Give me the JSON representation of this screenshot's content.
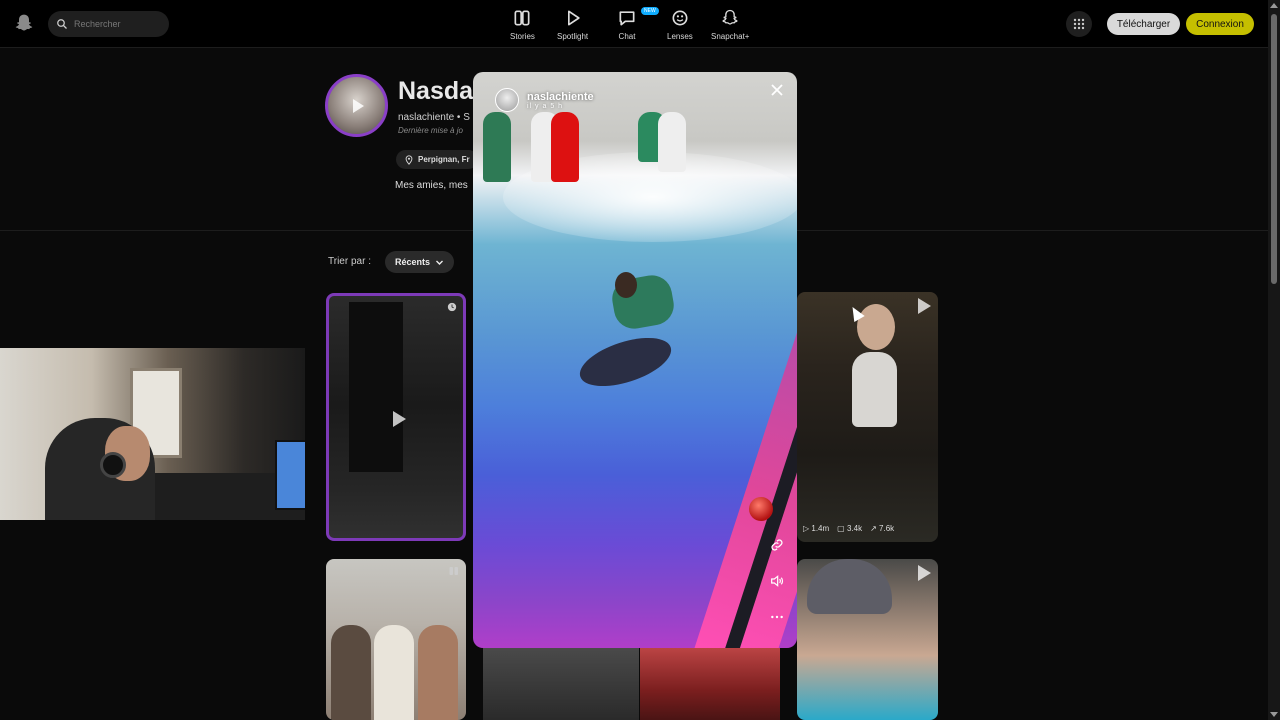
{
  "header": {
    "search_placeholder": "Rechercher",
    "nav": [
      {
        "label": "Stories",
        "icon": "stories-icon"
      },
      {
        "label": "Spotlight",
        "icon": "spotlight-play-icon"
      },
      {
        "label": "Chat",
        "icon": "chat-icon",
        "badge": "NEW"
      },
      {
        "label": "Lenses",
        "icon": "lenses-icon"
      },
      {
        "label": "Snapchat+",
        "icon": "snapchat-plus-icon"
      }
    ],
    "download_label": "Télécharger",
    "login_label": "Connexion",
    "accent": "#c5bf00"
  },
  "profile": {
    "display_name": "Nasdas",
    "username": "naslachiente  •  S",
    "last_update": "Dernière mise à jo",
    "location": "Perpignan, Fr",
    "bio": "Mes amies, mes"
  },
  "sort": {
    "label": "Trier par :",
    "value": "Récents"
  },
  "tiles": {
    "stats": {
      "views": "1.4m",
      "comments": "3.4k",
      "shares": "7.6k"
    }
  },
  "story": {
    "username": "naslachiente",
    "time": "il y a 5 h"
  },
  "colors": {
    "story_ring": "#8a3fc7",
    "background": "#0a0a0a"
  }
}
